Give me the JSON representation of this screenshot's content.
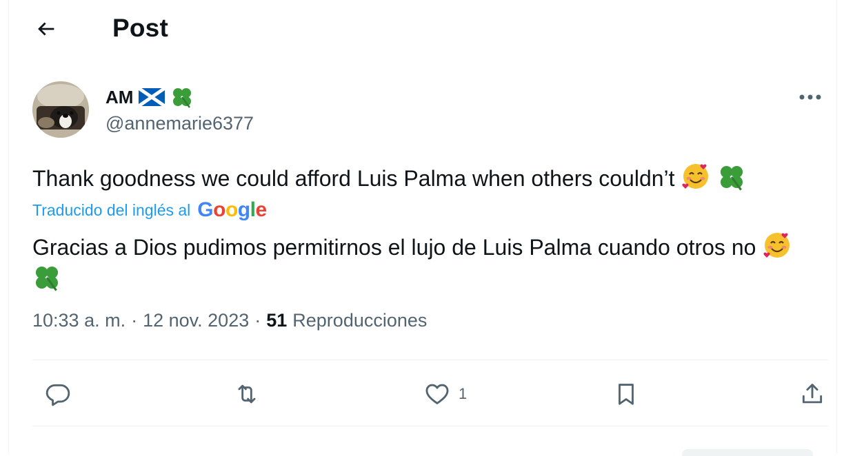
{
  "header": {
    "back_icon": "arrow-left-icon",
    "title": "Post"
  },
  "author": {
    "name": "AM",
    "name_emojis": [
      "scotland-flag",
      "four-leaf-clover"
    ],
    "handle": "@annemarie6377"
  },
  "tweet": {
    "text": "Thank goodness we could afford Luis Palma when others couldn’t",
    "text_emojis": [
      "smiling-face-with-hearts",
      "four-leaf-clover"
    ],
    "translate_label": "Traducido del inglés al",
    "translate_provider": "Google",
    "translated_text": "Gracias a Dios pudimos permitirnos el lujo de Luis Palma cuando otros no",
    "translated_emojis": [
      "smiling-face-with-hearts",
      "four-leaf-clover"
    ]
  },
  "meta": {
    "time": "10:33 a. m.",
    "separator": "·",
    "date": "12 nov. 2023",
    "views_count": "51",
    "views_label": "Reproducciones"
  },
  "actions": {
    "reply_icon": "reply-icon",
    "retweet_icon": "retweet-icon",
    "like_icon": "heart-icon",
    "like_count": "1",
    "bookmark_icon": "bookmark-icon",
    "share_icon": "share-icon"
  },
  "colors": {
    "text": "#0f1419",
    "secondary": "#536471",
    "link": "#1d9bf0",
    "divider": "#eff3f4"
  }
}
